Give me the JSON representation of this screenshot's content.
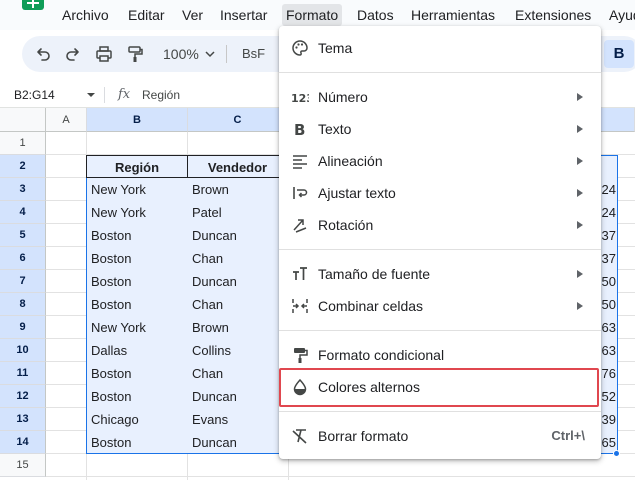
{
  "menubar": {
    "items": [
      "Archivo",
      "Editar",
      "Ver",
      "Insertar",
      "Formato",
      "Datos",
      "Herramientas",
      "Extensiones",
      "Ayud"
    ]
  },
  "toolbar": {
    "zoom": "100%",
    "font_label": "BsF",
    "bold_label": "B",
    "icons": [
      "undo-icon",
      "redo-icon",
      "print-icon",
      "paint-format-icon",
      "chevron-down-icon"
    ]
  },
  "formula_bar": {
    "name_box": "B2:G14",
    "fx_label": "fx",
    "value": "Región"
  },
  "grid": {
    "columns": [
      "A",
      "B",
      "C"
    ],
    "rows": [
      "1",
      "2",
      "3",
      "4",
      "5",
      "6",
      "7",
      "8",
      "9",
      "10",
      "11",
      "12",
      "13",
      "14",
      "15"
    ],
    "header": [
      "Región",
      "Vendedor"
    ],
    "data": [
      [
        "New York",
        "Brown",
        "24"
      ],
      [
        "New York",
        "Patel",
        "24"
      ],
      [
        "Boston",
        "Duncan",
        "37"
      ],
      [
        "Boston",
        "Chan",
        "37"
      ],
      [
        "Boston",
        "Duncan",
        "50"
      ],
      [
        "Boston",
        "Chan",
        "50"
      ],
      [
        "New York",
        "Brown",
        "63"
      ],
      [
        "Dallas",
        "Collins",
        "63"
      ],
      [
        "Boston",
        "Chan",
        "76"
      ],
      [
        "Boston",
        "Duncan",
        "52"
      ],
      [
        "Chicago",
        "Evans",
        "39"
      ],
      [
        "Boston",
        "Duncan",
        "65"
      ]
    ]
  },
  "format_menu": {
    "items": [
      {
        "label": "Tema",
        "icon": "palette-icon",
        "submenu": false
      },
      {
        "label": "Número",
        "icon": "number-123-icon",
        "submenu": true
      },
      {
        "label": "Texto",
        "icon": "bold-b-icon",
        "submenu": true
      },
      {
        "label": "Alineación",
        "icon": "align-left-icon",
        "submenu": true
      },
      {
        "label": "Ajustar texto",
        "icon": "wrap-text-icon",
        "submenu": true
      },
      {
        "label": "Rotación",
        "icon": "text-rotation-icon",
        "submenu": true
      },
      {
        "label": "Tamaño de fuente",
        "icon": "font-size-icon",
        "submenu": true
      },
      {
        "label": "Combinar celdas",
        "icon": "merge-cells-icon",
        "submenu": true
      },
      {
        "label": "Formato condicional",
        "icon": "paint-roller-icon",
        "submenu": false
      },
      {
        "label": "Colores alternos",
        "icon": "water-drop-icon",
        "submenu": false
      },
      {
        "label": "Borrar formato",
        "icon": "clear-format-icon",
        "submenu": false,
        "shortcut": "Ctrl+\\"
      }
    ]
  },
  "colors": {
    "accent": "#1a73e8",
    "selection_fill": "#e8f0fe",
    "header_selected": "#d3e3fd",
    "highlight_box": "#e0474f",
    "sheets_green": "#0f9d58"
  }
}
